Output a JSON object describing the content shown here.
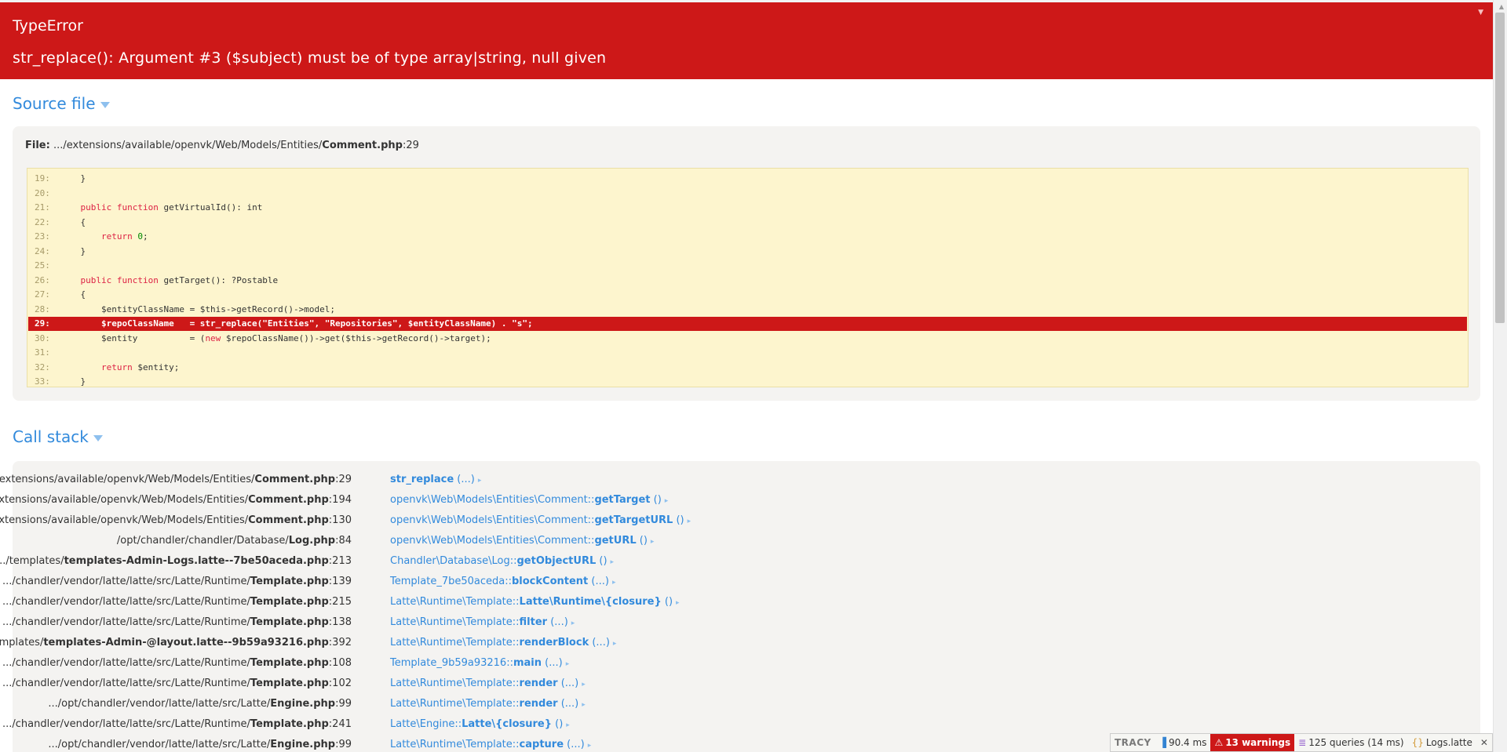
{
  "error": {
    "type": "TypeError",
    "message": "str_replace(): Argument #3 ($subject) must be of type array|string, null given",
    "toggle_icon": "collapse-triangle-icon"
  },
  "source": {
    "title": "Source file",
    "file_label": "File:",
    "file_path": ".../extensions/available/openvk/Web/Models/Entities/",
    "file_name": "Comment.php",
    "file_line": ":29",
    "lines": [
      {
        "n": "19:",
        "code": "    }"
      },
      {
        "n": "20:",
        "code": ""
      },
      {
        "n": "21:",
        "code": "    public function getVirtualId(): int"
      },
      {
        "n": "22:",
        "code": "    {"
      },
      {
        "n": "23:",
        "code": "        return 0;"
      },
      {
        "n": "24:",
        "code": "    }"
      },
      {
        "n": "25:",
        "code": ""
      },
      {
        "n": "26:",
        "code": "    public function getTarget(): ?Postable"
      },
      {
        "n": "27:",
        "code": "    {"
      },
      {
        "n": "28:",
        "code": "        $entityClassName = $this->getRecord()->model;"
      },
      {
        "n": "29:",
        "code": "        $repoClassName   = str_replace(\"Entities\", \"Repositories\", $entityClassName) . \"s\";"
      },
      {
        "n": "30:",
        "code": "        $entity          = (new $repoClassName())->get($this->getRecord()->target);"
      },
      {
        "n": "31:",
        "code": ""
      },
      {
        "n": "32:",
        "code": "        return $entity;"
      },
      {
        "n": "33:",
        "code": "    }"
      }
    ]
  },
  "callstack": {
    "title": "Call stack",
    "rows": [
      {
        "path": ".../extensions/available/openvk/Web/Models/Entities/",
        "file": "Comment.php",
        "line": ":29",
        "ns": "",
        "method": "str_replace",
        "args": " (...)"
      },
      {
        "path": ".../extensions/available/openvk/Web/Models/Entities/",
        "file": "Comment.php",
        "line": ":194",
        "ns": "openvk\\Web\\Models\\Entities\\Comment::",
        "method": "getTarget",
        "args": " ()"
      },
      {
        "path": ".../extensions/available/openvk/Web/Models/Entities/",
        "file": "Comment.php",
        "line": ":130",
        "ns": "openvk\\Web\\Models\\Entities\\Comment::",
        "method": "getTargetURL",
        "args": " ()"
      },
      {
        "path": "/opt/chandler/chandler/Database/",
        "file": "Log.php",
        "line": ":84",
        "ns": "openvk\\Web\\Models\\Entities\\Comment::",
        "method": "getURL",
        "args": " ()"
      },
      {
        "path": ".../templates/",
        "file": "templates-Admin-Logs.latte--7be50aceda.php",
        "line": ":213",
        "ns": "Chandler\\Database\\Log::",
        "method": "getObjectURL",
        "args": " ()"
      },
      {
        "path": ".../chandler/vendor/latte/latte/src/Latte/Runtime/",
        "file": "Template.php",
        "line": ":139",
        "ns": "Template_7be50aceda::",
        "method": "blockContent",
        "args": " (...)"
      },
      {
        "path": ".../chandler/vendor/latte/latte/src/Latte/Runtime/",
        "file": "Template.php",
        "line": ":215",
        "ns": "Latte\\Runtime\\Template::",
        "method": "Latte\\Runtime\\{closure}",
        "args": " ()"
      },
      {
        "path": ".../chandler/vendor/latte/latte/src/Latte/Runtime/",
        "file": "Template.php",
        "line": ":138",
        "ns": "Latte\\Runtime\\Template::",
        "method": "filter",
        "args": " (...)"
      },
      {
        "path": ".../templates/",
        "file": "templates-Admin-@layout.latte--9b59a93216.php",
        "line": ":392",
        "ns": "Latte\\Runtime\\Template::",
        "method": "renderBlock",
        "args": " (...)"
      },
      {
        "path": ".../chandler/vendor/latte/latte/src/Latte/Runtime/",
        "file": "Template.php",
        "line": ":108",
        "ns": "Template_9b59a93216::",
        "method": "main",
        "args": " (...)"
      },
      {
        "path": ".../chandler/vendor/latte/latte/src/Latte/Runtime/",
        "file": "Template.php",
        "line": ":102",
        "ns": "Latte\\Runtime\\Template::",
        "method": "render",
        "args": " (...)"
      },
      {
        "path": ".../opt/chandler/vendor/latte/latte/src/Latte/",
        "file": "Engine.php",
        "line": ":99",
        "ns": "Latte\\Runtime\\Template::",
        "method": "render",
        "args": " (...)"
      },
      {
        "path": ".../chandler/vendor/latte/latte/src/Latte/Runtime/",
        "file": "Template.php",
        "line": ":241",
        "ns": "Latte\\Engine::",
        "method": "Latte\\{closure}",
        "args": " ()"
      },
      {
        "path": ".../opt/chandler/vendor/latte/latte/src/Latte/",
        "file": "Engine.php",
        "line": ":99",
        "ns": "Latte\\Runtime\\Template::",
        "method": "capture",
        "args": " (...)"
      }
    ]
  },
  "tracy": {
    "logo": "TRACY",
    "time": "90.4 ms",
    "warnings": "13 warnings",
    "queries": "125 queries (14 ms)",
    "template": "Logs.latte",
    "close": "✕",
    "icons": {
      "time": "bar-chart-icon",
      "warnings": "warning-icon",
      "queries": "database-icon",
      "template": "latte-icon",
      "close": "close-icon"
    }
  }
}
